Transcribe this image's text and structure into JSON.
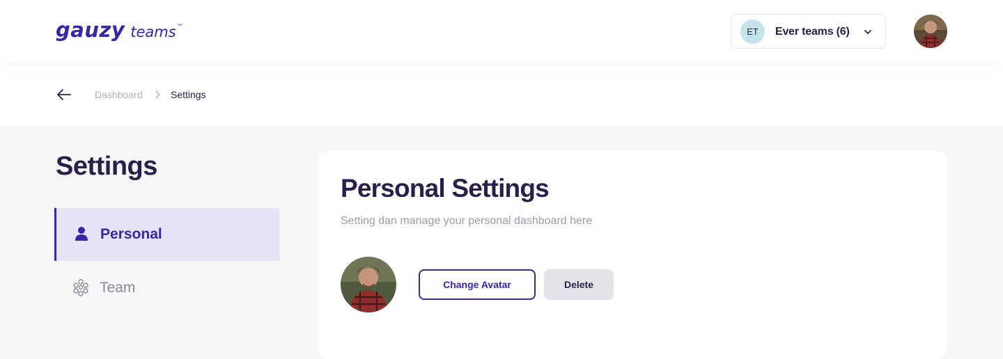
{
  "header": {
    "logo_main": "gauzy",
    "logo_sub": "teams",
    "logo_tm": "™",
    "team": {
      "initials": "ET",
      "name": "Ever teams (6)"
    }
  },
  "breadcrumb": {
    "items": [
      "Dashboard",
      "Settings"
    ]
  },
  "sidebar": {
    "title": "Settings",
    "items": [
      {
        "label": "Personal",
        "icon": "user-icon",
        "active": true
      },
      {
        "label": "Team",
        "icon": "team-icon",
        "active": false
      }
    ]
  },
  "main": {
    "title": "Personal Settings",
    "subtitle": "Setting dan manage your personal dashboard here",
    "change_avatar_label": "Change Avatar",
    "delete_label": "Delete"
  },
  "colors": {
    "brand": "#3826a6",
    "active_bg": "#e6e3f7",
    "text_dark": "#282048",
    "muted": "#9e9bab",
    "page_bg": "#f7f7f8"
  }
}
